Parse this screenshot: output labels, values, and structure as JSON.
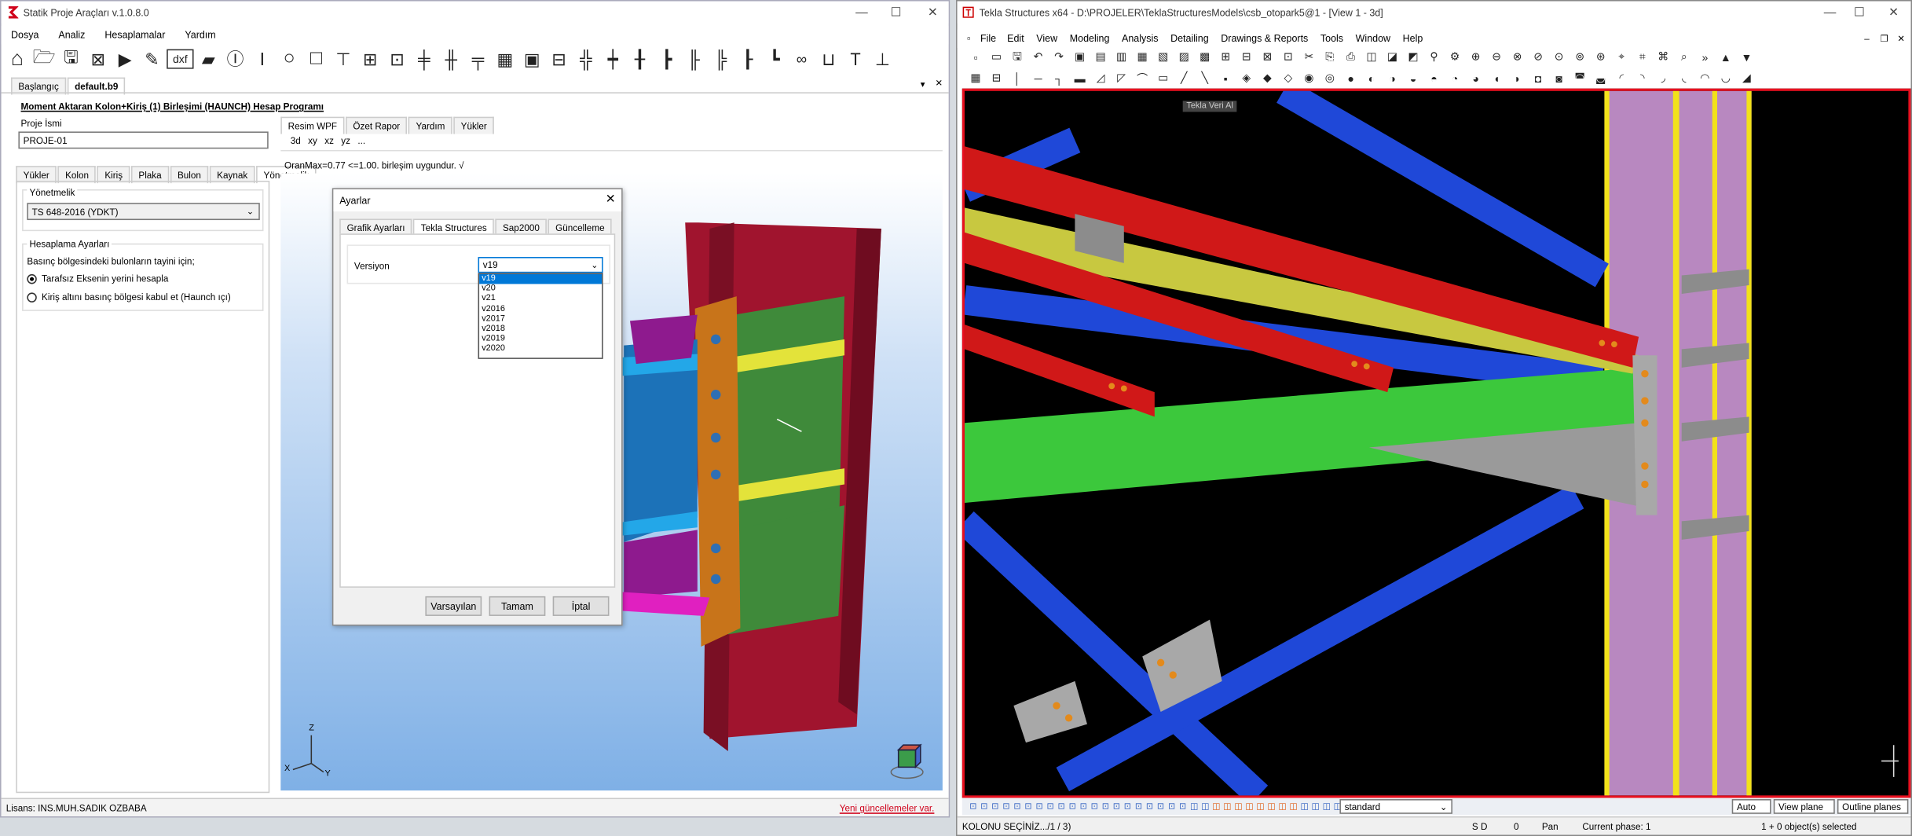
{
  "left": {
    "title": "Statik Proje Araçları v.1.0.8.0",
    "menu": [
      "Dosya",
      "Analiz",
      "Hesaplamalar",
      "Yardım"
    ],
    "doc_tabs": [
      "Başlangıç",
      "default.b9"
    ],
    "form_title": "Moment Aktaran Kolon+Kiriş (1) Birleşimi (HAUNCH) Hesap Programı",
    "proje_label": "Proje İsmi",
    "proje_value": "PROJE-01",
    "input_tabs": [
      "Yükler",
      "Kolon",
      "Kiriş",
      "Plaka",
      "Bulon",
      "Kaynak",
      "Yönetmelik"
    ],
    "yonetmelik_group": "Yönetmelik",
    "yonetmelik_value": "TS 648-2016 (YDKT)",
    "hesap_group": "Hesaplama Ayarları",
    "basinc_label": "Basınç bölgesindeki bulonların tayini için;",
    "radio1": "Tarafsız Eksenin yerini hesapla",
    "radio2": "Kiriş altını basınç bölgesi kabul et (Haunch ıçı)",
    "view_tabs": [
      "Resim WPF",
      "Özet Rapor",
      "Yardım",
      "Yükler"
    ],
    "view_buttons": [
      "3d",
      "xy",
      "xz",
      "yz",
      "..."
    ],
    "oran_text": "OranMax=0.77 <=1.00. birleşim uygundur. √",
    "license": "Lisans: INS.MUH.SADIK OZBABA",
    "update_link": "Yeni güncellemeler var.",
    "axis": {
      "z": "Z",
      "x": "X",
      "y": "Y"
    }
  },
  "dialog": {
    "title": "Ayarlar",
    "tabs": [
      "Grafik Ayarları",
      "Tekla Structures",
      "Sap2000",
      "Güncelleme"
    ],
    "version_label": "Versiyon",
    "version_value": "v19",
    "options": [
      "v19",
      "v20",
      "v21",
      "v2016",
      "v2017",
      "v2018",
      "v2019",
      "v2020"
    ],
    "buttons": [
      "Varsayılan",
      "Tamam",
      "İptal"
    ]
  },
  "right": {
    "title": "Tekla Structures x64 - D:\\PROJELER\\TeklaStructuresModels\\csb_otopark5@1 - [View 1 - 3d]",
    "menu": [
      "File",
      "Edit",
      "View",
      "Modeling",
      "Analysis",
      "Detailing",
      "Drawings & Reports",
      "Tools",
      "Window",
      "Help"
    ],
    "tooltip": "Tekla Veri Al",
    "snap_combo": "standard",
    "auto": "Auto",
    "view_plane": "View plane",
    "outline": "Outline planes",
    "status_left": "KOLONU SEÇİNİZ.../1 / 3)",
    "sd": "S D",
    "zero": "0",
    "pan": "Pan",
    "phase": "Current phase: 1",
    "selected": "1 + 0 object(s) selected"
  },
  "colors": {
    "accent": "#0078d7",
    "tekla_frame": "#e8101f",
    "model_bg": "#000000",
    "wpf_bg": "#88b6e8"
  }
}
